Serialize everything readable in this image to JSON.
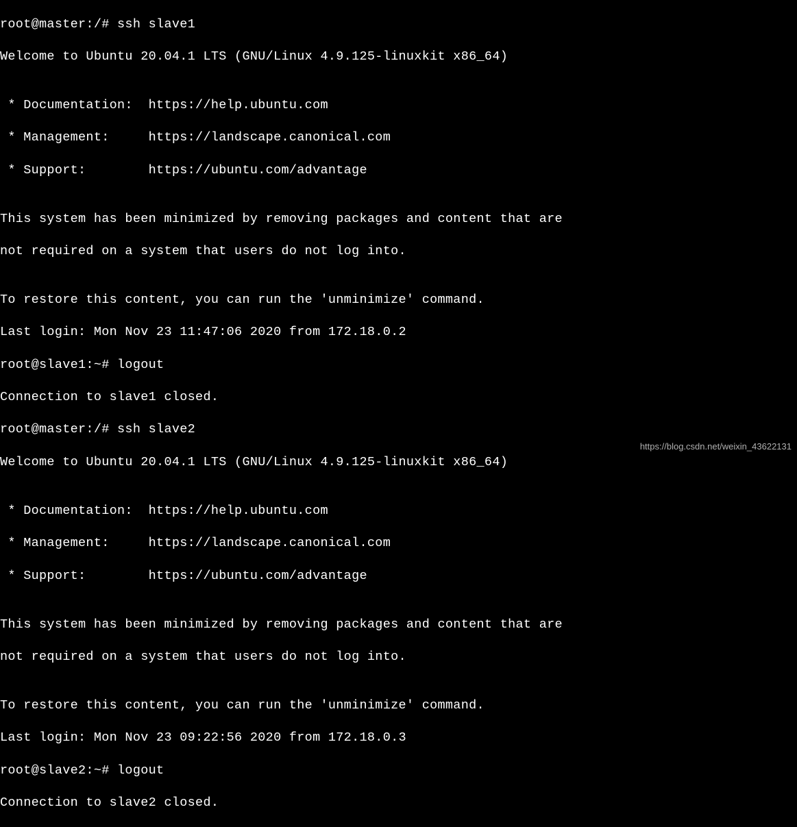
{
  "terminal": {
    "lines": [
      "root@master:/# ssh slave1",
      "Welcome to Ubuntu 20.04.1 LTS (GNU/Linux 4.9.125-linuxkit x86_64)",
      "",
      " * Documentation:  https://help.ubuntu.com",
      " * Management:     https://landscape.canonical.com",
      " * Support:        https://ubuntu.com/advantage",
      "",
      "This system has been minimized by removing packages and content that are",
      "not required on a system that users do not log into.",
      "",
      "To restore this content, you can run the 'unminimize' command.",
      "Last login: Mon Nov 23 11:47:06 2020 from 172.18.0.2",
      "root@slave1:~# logout",
      "Connection to slave1 closed.",
      "root@master:/# ssh slave2",
      "Welcome to Ubuntu 20.04.1 LTS (GNU/Linux 4.9.125-linuxkit x86_64)",
      "",
      " * Documentation:  https://help.ubuntu.com",
      " * Management:     https://landscape.canonical.com",
      " * Support:        https://ubuntu.com/advantage",
      "",
      "This system has been minimized by removing packages and content that are",
      "not required on a system that users do not log into.",
      "",
      "To restore this content, you can run the 'unminimize' command.",
      "Last login: Mon Nov 23 09:22:56 2020 from 172.18.0.3",
      "root@slave2:~# logout",
      "Connection to slave2 closed."
    ]
  },
  "watermark": "https://blog.csdn.net/weixin_43622131"
}
